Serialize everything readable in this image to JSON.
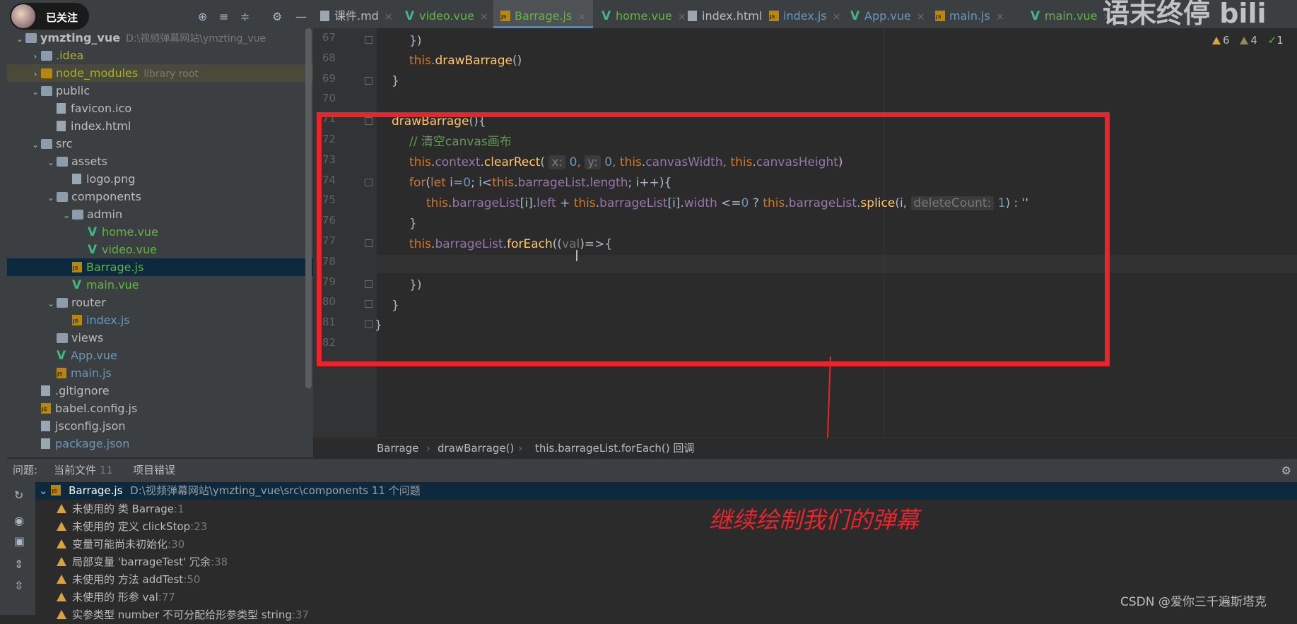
{
  "project_tree": [
    {
      "label": "ymzting_vue",
      "suffix": "D:\\视频弹幕网站\\ymzting_vue",
      "depth": 0,
      "arrow": "⌄",
      "icon": "folder",
      "color": "#bbbbbb",
      "bold": true
    },
    {
      "label": ".idea",
      "depth": 1,
      "arrow": "›",
      "icon": "folder",
      "color": "#a8ad3c"
    },
    {
      "label": "node_modules",
      "suffix": "library root",
      "depth": 1,
      "arrow": "›",
      "icon": "folder-orange",
      "color": "#a8ad3c",
      "highlight": true
    },
    {
      "label": "public",
      "depth": 1,
      "arrow": "⌄",
      "icon": "folder",
      "color": "#bbbbbb"
    },
    {
      "label": "favicon.ico",
      "depth": 2,
      "icon": "doc",
      "color": "#bbbbbb"
    },
    {
      "label": "index.html",
      "depth": 2,
      "icon": "doc",
      "color": "#bbbbbb"
    },
    {
      "label": "src",
      "depth": 1,
      "arrow": "⌄",
      "icon": "folder",
      "color": "#bbbbbb"
    },
    {
      "label": "assets",
      "depth": 2,
      "arrow": "⌄",
      "icon": "folder",
      "color": "#bbbbbb"
    },
    {
      "label": "logo.png",
      "depth": 3,
      "icon": "doc",
      "color": "#bbbbbb"
    },
    {
      "label": "components",
      "depth": 2,
      "arrow": "⌄",
      "icon": "folder",
      "color": "#bbbbbb"
    },
    {
      "label": "admin",
      "depth": 3,
      "arrow": "⌄",
      "icon": "folder",
      "color": "#bbbbbb"
    },
    {
      "label": "home.vue",
      "depth": 4,
      "icon": "vue",
      "color": "#62b543"
    },
    {
      "label": "video.vue",
      "depth": 4,
      "icon": "vue",
      "color": "#62b543"
    },
    {
      "label": "Barrage.js",
      "depth": 3,
      "icon": "js",
      "color": "#62b543",
      "selected": true
    },
    {
      "label": "main.vue",
      "depth": 3,
      "icon": "vue",
      "color": "#62b543"
    },
    {
      "label": "router",
      "depth": 2,
      "arrow": "⌄",
      "icon": "folder",
      "color": "#bbbbbb"
    },
    {
      "label": "index.js",
      "depth": 3,
      "icon": "js",
      "color": "#6897bb"
    },
    {
      "label": "views",
      "depth": 2,
      "icon": "folder",
      "color": "#bbbbbb"
    },
    {
      "label": "App.vue",
      "depth": 2,
      "icon": "vue",
      "color": "#6897bb"
    },
    {
      "label": "main.js",
      "depth": 2,
      "icon": "js",
      "color": "#6897bb"
    },
    {
      "label": ".gitignore",
      "depth": 1,
      "icon": "doc",
      "color": "#bbbbbb"
    },
    {
      "label": "babel.config.js",
      "depth": 1,
      "icon": "js",
      "color": "#bbbbbb"
    },
    {
      "label": "jsconfig.json",
      "depth": 1,
      "icon": "doc",
      "color": "#bbbbbb"
    },
    {
      "label": "package.json",
      "depth": 1,
      "icon": "doc",
      "color": "#6897bb"
    }
  ],
  "tabs": [
    {
      "label": "课件.md",
      "color": "#bbbbbb",
      "icon": "md"
    },
    {
      "label": "video.vue",
      "color": "#62b543",
      "icon": "vue"
    },
    {
      "label": "Barrage.js",
      "color": "#62b543",
      "icon": "js",
      "active": true
    },
    {
      "label": "home.vue",
      "color": "#62b543",
      "icon": "vue"
    },
    {
      "label": "index.html",
      "color": "#bbbbbb",
      "icon": "html"
    },
    {
      "label": "index.js",
      "color": "#6897bb",
      "icon": "js"
    },
    {
      "label": "App.vue",
      "color": "#6897bb",
      "icon": "vue"
    },
    {
      "label": "main.js",
      "color": "#6897bb",
      "icon": "js"
    },
    {
      "label": "main.vue",
      "color": "#62b543",
      "icon": "vue"
    }
  ],
  "line_numbers": [
    "67",
    "68",
    "69",
    "70",
    "71",
    "72",
    "73",
    "74",
    "75",
    "76",
    "77",
    "78",
    "79",
    "80",
    "81",
    "82"
  ],
  "code": {
    "l67": "})",
    "l68_this": "this",
    "l68_call": "drawBarrage",
    "l68_paren": "()",
    "l69": "}",
    "l71_fn": "drawBarrage",
    "l71_rest": "(){",
    "l72_comment": "// 清空canvas画布",
    "l73": {
      "this1": "this",
      "dot1": ".",
      "ctx": "context",
      "dot2": ".",
      "fn": "clearRect",
      "open": "(",
      "hint_x": "x:",
      "v0a": "0",
      ",a": ",",
      "hint_y": "y:",
      "v0b": "0",
      ",b": ",",
      "this2": "this",
      "dot3": ".",
      "w": "canvasWidth",
      ",c": ",",
      "this3": "this",
      "dot4": ".",
      "h": "canvasHeight",
      "close": ")"
    },
    "l74": {
      "for": "for",
      "p1": "(",
      "let": "let",
      "a": " i=",
      "zero": "0",
      "b": "; i<",
      "this": "this",
      "dot": ".",
      "list": "barrageList",
      "dot2": ".",
      "len": "length",
      "c": "; i++){"
    },
    "l75": {
      "this1": "this",
      "d1": ".",
      "list1": "barrageList",
      "idx1": "[i]",
      "d2": ".",
      "left": "left",
      "plus": " + ",
      "this2": "this",
      "d3": ".",
      "list2": "barrageList",
      "idx2": "[i]",
      "d4": ".",
      "width": "width",
      "le": " <=",
      "zero": "0",
      "q": " ? ",
      "this3": "this",
      "d5": ".",
      "list3": "barrageList",
      "d6": ".",
      "splice": "splice",
      "open": "(i, ",
      "hint": "deleteCount:",
      "one": "1",
      ") : ''": ") : ''"
    },
    "l76": "}",
    "l77": {
      "this": "this",
      "d": ".",
      "list": "barrageList",
      "d2": ".",
      "fn": "forEach",
      "open": "((",
      "val": "val",
      "rest": ")=>{"
    },
    "l79": "})",
    "l80": "}",
    "l81": "}"
  },
  "breadcrumb": [
    "Barrage",
    "drawBarrage()",
    "this.barrageList.forEach() 回调"
  ],
  "breadcrumb_sep": "›",
  "problems": {
    "tab_label": "问题:",
    "tabs": [
      {
        "label": "当前文件",
        "count": "11"
      },
      {
        "label": "项目错误"
      }
    ],
    "file": "Barrage.js",
    "file_path": "D:\\视频弹幕网站\\ymzting_vue\\src\\components  11 个问题",
    "items": [
      {
        "text": "未使用的 类 Barrage",
        "line": ":1"
      },
      {
        "text": "未使用的 定义 clickStop",
        "line": ":23"
      },
      {
        "text": "变量可能尚未初始化",
        "line": ":30"
      },
      {
        "text": "局部变量 'barrageTest' 冗余",
        "line": ":38"
      },
      {
        "text": "未使用的 方法 addTest",
        "line": ":50"
      },
      {
        "text": "未使用的 形参 val",
        "line": ":77"
      },
      {
        "text": "实参类型 number 不可分配给形参类型 string",
        "line": ":37"
      }
    ]
  },
  "inspection_counts": {
    "warnings": "6",
    "weak": "4",
    "ok": "1"
  },
  "annotation": "继续绘制我们的弹幕",
  "csdn_credit": "CSDN @爱你三千遍斯塔克",
  "watermark": "语末终停 bili",
  "follow_label": "已关注",
  "colors": {
    "annotation_red": "#e8242c",
    "selection": "#0d293e",
    "editor_bg": "#2b2b2b",
    "panel_bg": "#3c3f41"
  }
}
